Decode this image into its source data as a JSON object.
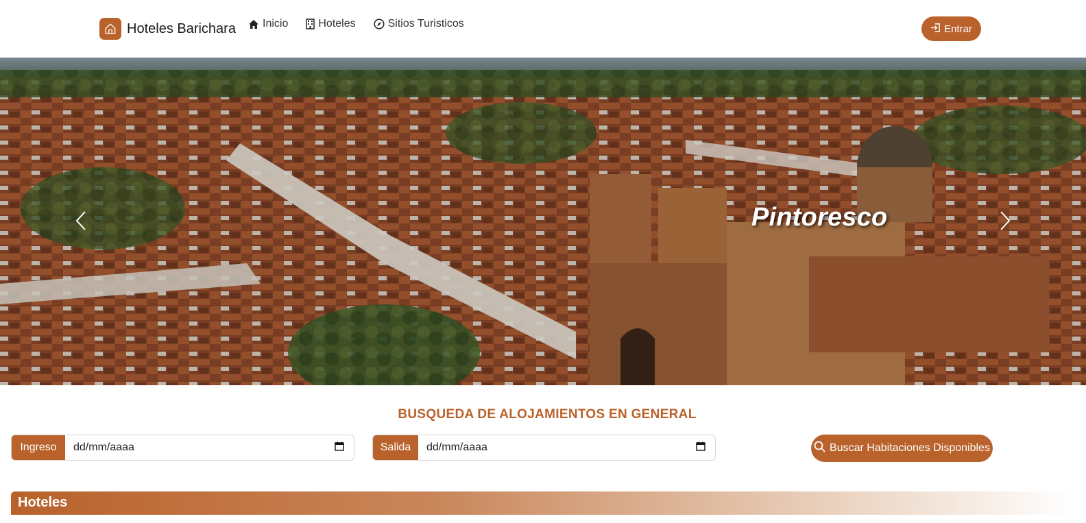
{
  "navbar": {
    "brand": "Hoteles Barichara",
    "links": [
      {
        "label": "Inicio",
        "icon": "house-icon"
      },
      {
        "label": "Hoteles",
        "icon": "building-icon"
      },
      {
        "label": "Sitios Turisticos",
        "icon": "compass-icon"
      }
    ],
    "login_label": "Entrar",
    "login_icon": "login-icon"
  },
  "hero": {
    "caption": "Pintoresco",
    "prev_icon": "chevron-left-icon",
    "next_icon": "chevron-right-icon"
  },
  "search": {
    "title": "BUSQUEDA DE ALOJAMIENTOS EN GENERAL",
    "checkin_label": "Ingreso",
    "checkin_value": "dd/mm/aaaa",
    "checkout_label": "Salida",
    "checkout_value": "dd/mm/aaaa",
    "button_label": "Buscar Habitaciones Disponibles",
    "button_icon": "search-icon"
  },
  "hotels_section": {
    "title": "Hoteles"
  },
  "colors": {
    "accent": "#b9622b"
  }
}
